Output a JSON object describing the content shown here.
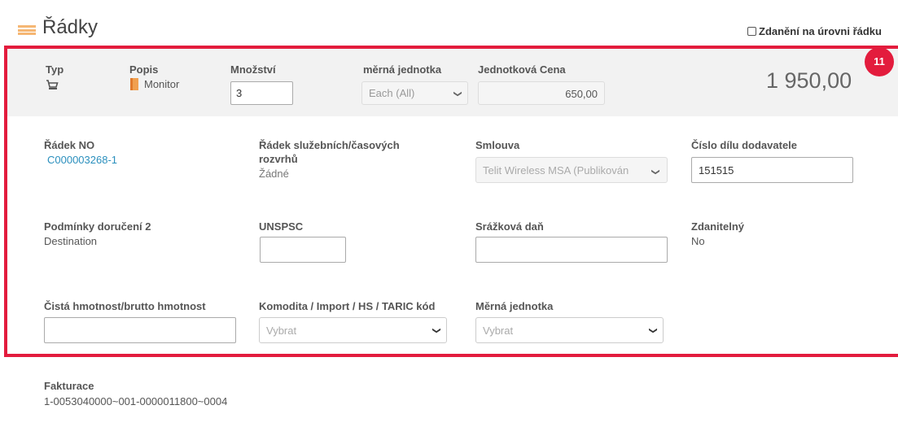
{
  "header": {
    "title": "Řádky",
    "line_level_tax_label": "Zdanění na úrovni řádku",
    "line_level_tax_checked": false
  },
  "line_summary": {
    "type_label": "Typ",
    "type_icon": "cart-icon",
    "description_label": "Popis",
    "description_value": "Monitor",
    "quantity_label": "Množství",
    "quantity_value": "3",
    "uom_label": "měrná jednotka",
    "uom_value": "Each (All)",
    "unit_price_label": "Jednotková Cena",
    "unit_price_value": "650,00",
    "total": "1 950,00",
    "badge": "11"
  },
  "details": {
    "line_no_label": "Řádek NO",
    "line_no_value": "C000003268-1",
    "schedule_label_1": "Řádek služebních/časových",
    "schedule_label_2": "rozvrhů",
    "schedule_value": "Žádné",
    "contract_label": "Smlouva",
    "contract_value": "Telit Wireless MSA (Publikován",
    "supplier_part_label": "Číslo dílu dodavatele",
    "supplier_part_value": "151515",
    "delivery_terms_label": "Podmínky doručení 2",
    "delivery_terms_value": "Destination",
    "unspsc_label": "UNSPSC",
    "unspsc_value": "",
    "withholding_tax_label": "Srážková daň",
    "withholding_tax_value": "",
    "taxable_label": "Zdanitelný",
    "taxable_value": "No",
    "weight_label": "Čistá hmotnost/brutto hmotnost",
    "weight_value": "",
    "commodity_label": "Komodita / Import / HS / TARIC kód",
    "commodity_placeholder": "Vybrat",
    "measure_unit_label": "Měrná jednotka",
    "measure_unit_placeholder": "Vybrat"
  },
  "billing": {
    "label": "Fakturace",
    "value": "1-0053040000~001-0000011800~0004"
  },
  "colors": {
    "highlight": "#e31c3d",
    "link": "#2a8fbd",
    "row_background": "#f2f2f2"
  }
}
